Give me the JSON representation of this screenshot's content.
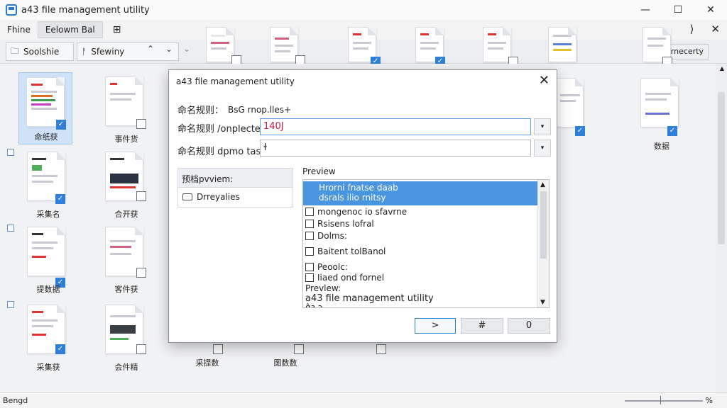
{
  "window": {
    "title": "a43 file management utility",
    "controls": {
      "minimize": "—",
      "maximize": "☐",
      "close": "✕"
    }
  },
  "menubar": {
    "items": [
      {
        "label": "Fhine"
      },
      {
        "label": "Eelowm Bal"
      }
    ],
    "grid_glyph": "⊞",
    "right_glyphs": {
      "redo": "⟩",
      "close": "✕"
    }
  },
  "toolbar": {
    "folder_glyph": "🗀",
    "location": "Soolshie",
    "view_glyph": "ᚨ",
    "view": "Sfewiny",
    "up_glyph": "⌃",
    "down_glyph": "⌄",
    "expand_glyph": "⌄",
    "sort": "Srnecerty"
  },
  "grid": {
    "labels": [
      "命纸获",
      "事件货",
      "数据",
      "采集名",
      "合开获",
      "提数据",
      "客件获",
      "采集获",
      "会件精",
      "采提数",
      "图数数"
    ]
  },
  "statusbar": {
    "left": "Bengd",
    "right": "%"
  },
  "dialog": {
    "title": "a43 file management utility",
    "close_glyph": "✕",
    "rule_label": "命名规则：",
    "rule_value": "BsG rnop.lles+",
    "complete_label": "命名规则 /onplectex",
    "complete_value": "140J",
    "demo_label": "命名规则 dpmo tase",
    "demo_value": "ɫ",
    "dropdown_glyph": "▾",
    "left_panel_head": "预档pvviem:",
    "left_panel_item": "Drreyalies",
    "preview_label": "Preview",
    "preview_rows": {
      "sel_line1": "Hrorni fnatse daab",
      "sel_line2": "dsrals ilio rnitsy",
      "row1": "mongenoc io sfavrne",
      "row2": "Rsisens lofral",
      "row3": "Dolms:",
      "row4": "Baitent tolBanol",
      "row5": "Peoolc:",
      "row6": "Iiaed ond fornel",
      "row7": "Prevlew:",
      "row8": "a43 file management utility",
      "row9": "ɑ̂ɜ ɔ"
    },
    "scroll_up": "▲",
    "scroll_down": "▼",
    "buttons": {
      "next": ">",
      "hash": "#",
      "zero": "0"
    }
  }
}
